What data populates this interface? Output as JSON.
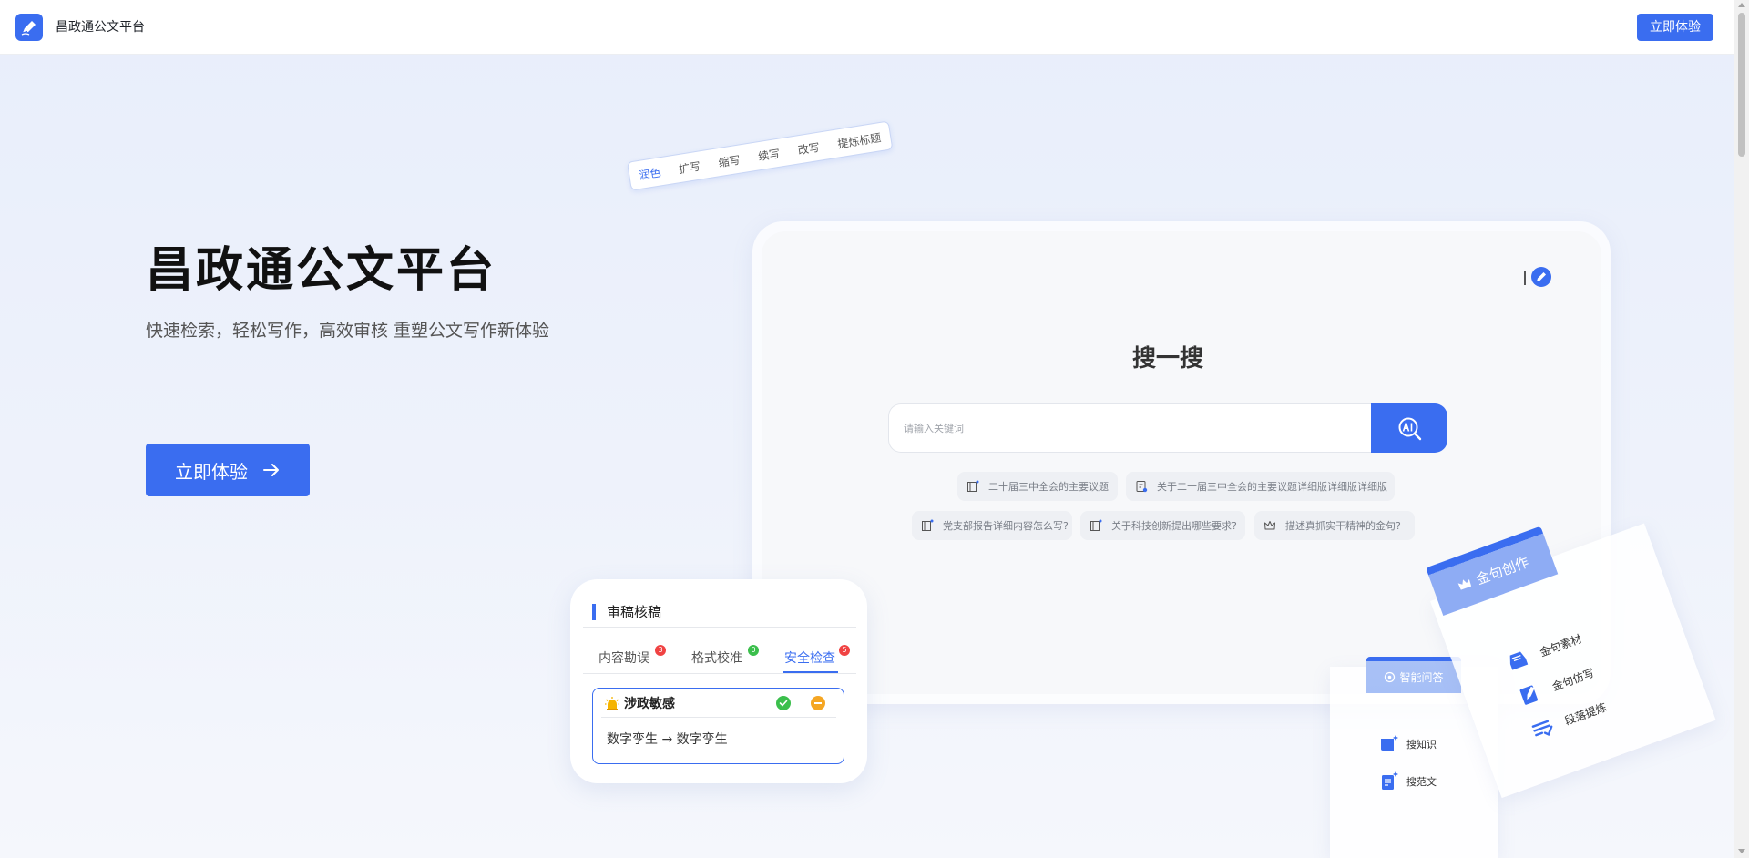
{
  "header": {
    "brand": "昌政通公文平台",
    "cta_label": "立即体验"
  },
  "hero": {
    "title": "昌政通公文平台",
    "subtitle": "快速检索，轻松写作，高效审核 重塑公文写作新体验",
    "cta_label": "立即体验",
    "cta_icon": "arrow-right-icon"
  },
  "toolbar": {
    "items": [
      "润色",
      "扩写",
      "缩写",
      "续写",
      "改写",
      "提炼标题"
    ],
    "active_index": 0
  },
  "search": {
    "title": "搜一搜",
    "placeholder": "请输入关键词",
    "button_icon": "ai-search-icon",
    "suggestions": [
      "二十届三中全会的主要议题",
      "关于二十届三中全会的主要议题详细版详细版详细版",
      "党支部报告详细内容怎么写?",
      "关于科技创新提出哪些要求?",
      "描述真抓实干精神的金句?"
    ]
  },
  "review": {
    "title": "审稿核稿",
    "tabs": [
      {
        "label": "内容勘误",
        "count": "3"
      },
      {
        "label": "格式校准",
        "count": "0"
      },
      {
        "label": "安全检查",
        "count": "5"
      }
    ],
    "active_tab": 2,
    "issue": {
      "type": "涉政敏感",
      "text": "数字孪生 → 数字孪生"
    }
  },
  "qa": {
    "title": "智能问答",
    "items": [
      "搜知识",
      "搜范文"
    ]
  },
  "gold": {
    "title": "金句创作",
    "items": [
      "金句素材",
      "金句仿写",
      "段落提炼"
    ]
  },
  "colors": {
    "accent": "#3a6df0",
    "badge_red": "#f04343",
    "badge_green": "#3bbf4c",
    "warning": "#f5a623"
  }
}
